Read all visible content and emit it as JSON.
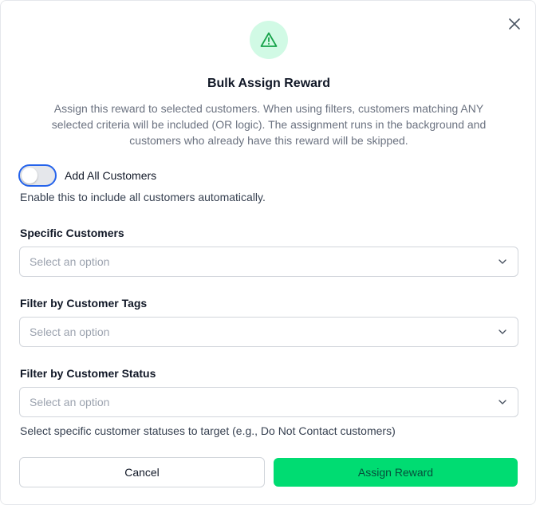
{
  "dialog": {
    "title": "Bulk Assign Reward",
    "description": "Assign this reward to selected customers. When using filters, customers matching ANY selected criteria will be included (OR logic). The assignment runs in the background and customers who already have this reward will be skipped.",
    "close_icon": "close-icon",
    "header_icon": "warning-triangle-icon"
  },
  "toggle": {
    "label": "Add All Customers",
    "checked": false,
    "hint": "Enable this to include all customers automatically."
  },
  "fields": {
    "specific_customers": {
      "label": "Specific Customers",
      "placeholder": "Select an option"
    },
    "customer_tags": {
      "label": "Filter by Customer Tags",
      "placeholder": "Select an option"
    },
    "customer_status": {
      "label": "Filter by Customer Status",
      "placeholder": "Select an option",
      "hint": "Select specific customer statuses to target (e.g., Do Not Contact customers)"
    }
  },
  "actions": {
    "cancel_label": "Cancel",
    "assign_label": "Assign Reward"
  },
  "colors": {
    "accent": "#00dc72",
    "icon_bg": "#d1fae5",
    "icon_stroke": "#16a34a",
    "toggle_focus": "#2563eb"
  }
}
